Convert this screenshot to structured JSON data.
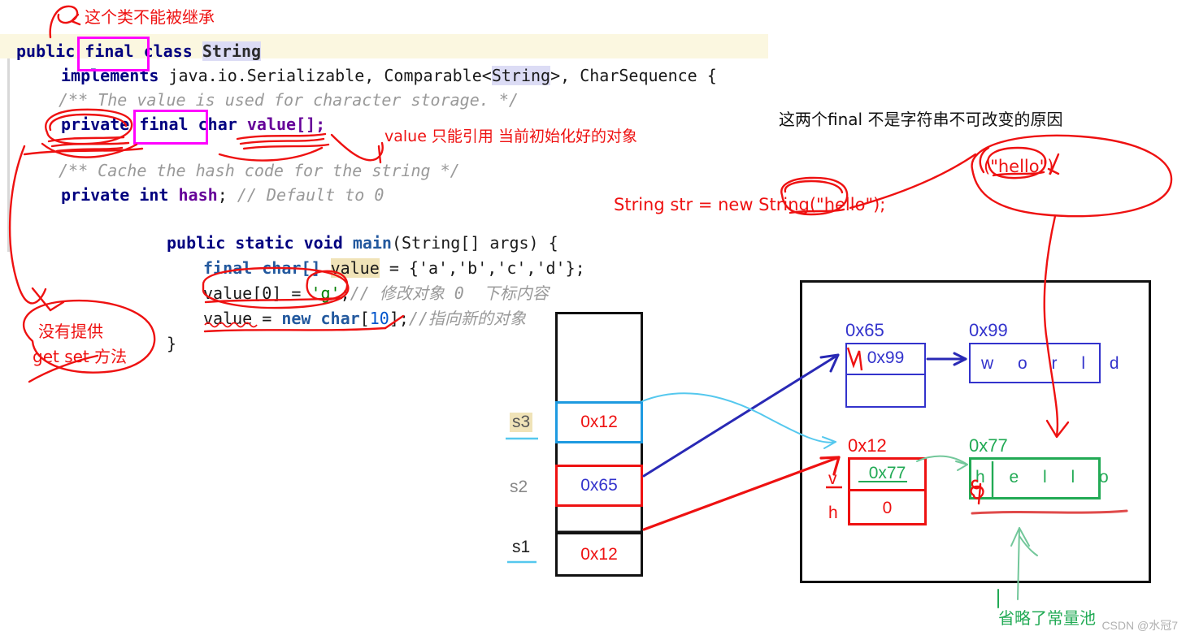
{
  "code": {
    "lines": [
      {
        "id": "l1",
        "text": "public final class String"
      },
      {
        "id": "l2",
        "text": "implements java.io.Serializable, Comparable<String>, CharSequence {"
      },
      {
        "id": "l3",
        "text": "/** The value is used for character storage. */"
      },
      {
        "id": "l4",
        "text": "private final char value[];"
      },
      {
        "id": "l5",
        "text": "/** Cache the hash code for the string */"
      },
      {
        "id": "l6",
        "text": "private int hash; // Default to 0"
      },
      {
        "id": "l7",
        "text": "public static void main(String[] args) {"
      },
      {
        "id": "l8",
        "text": "final char[] value = {'a','b','c','d'};"
      },
      {
        "id": "l9",
        "text": "value[0] = 'g';// 修改对象 0  下标内容"
      },
      {
        "id": "l10",
        "text": "value = new char[10];//指向新的对象"
      },
      {
        "id": "l11",
        "text": "}"
      }
    ],
    "tokens": {
      "public": "public",
      "final": "final",
      "class": "class",
      "string_type": "String",
      "implements": "implements",
      "serializable": "java.io.Serializable,",
      "comparable_pre": "Comparable<",
      "comparable_arg": "String",
      "comparable_post": ">, CharSequence {",
      "comment_value": "/** The value is used for character storage. */",
      "private": "private",
      "char": "char",
      "value_decl": "value[];",
      "comment_hash": "/** Cache the hash code for the string */",
      "int": "int",
      "hash": "hash",
      "semi": ";",
      "comment_default": "// Default to 0",
      "static": "static",
      "void": "void",
      "main": "main",
      "main_args": "(String[] args) {",
      "char_arr": "char[]",
      "value_name": "value",
      "assign_abcd": "= {'a','b','c','d'};",
      "value_idx": "value[0] =",
      "g_literal": "'g'",
      "semi2": ";",
      "comment_modify": "// 修改对象 0  下标内容",
      "value_eq": "value = ",
      "new": "new",
      "char2": "char",
      "bracket10_open": "[",
      "ten": "10",
      "bracket10_close": "];",
      "comment_newobj": "//指向新的对象",
      "close_brace": "}"
    }
  },
  "annotations": {
    "cannot_inherit": "这个类不能被继承",
    "value_ref_only": "value 只能引用 当前初始化好的对象",
    "two_final_reason": "这两个final  不是字符串不可改变的原因",
    "no_get_set_line1": "没有提供",
    "no_get_set_line2": "get  set 方法",
    "new_string_stmt": "String str = new String(\"hello\");",
    "hello_circled": "(\"hello\")",
    "constant_pool_omitted": "省略了常量池"
  },
  "stack": {
    "slots": [
      {
        "label": "s3",
        "value": "0x12",
        "border": "#1e9ae0",
        "value_color": "#ee1111"
      },
      {
        "label": "s2",
        "value": "0x65",
        "border": "#ee1111",
        "value_color": "#3333cc"
      },
      {
        "label": "s1",
        "value": "0x12",
        "border": "#111111",
        "value_color": "#ee1111"
      }
    ]
  },
  "heap": {
    "objects": [
      {
        "addr": "0x65",
        "color": "#3333cc",
        "field_value": "0x99",
        "field2_value": ""
      },
      {
        "addr": "0x99",
        "color": "#3333cc",
        "chars": "w o r l d"
      },
      {
        "addr": "0x12",
        "color": "#ee1111",
        "field_value": "0x77",
        "field2_value": "0",
        "field_labels": [
          "v",
          "h"
        ],
        "field_value_color": "#22aa55"
      },
      {
        "addr": "0x77",
        "color": "#22aa55",
        "chars": "h e l l o"
      }
    ]
  },
  "watermark": "CSDN @水冠7",
  "colors": {
    "red": "#ee1111",
    "blue": "#3333cc",
    "green": "#22aa55",
    "cyan": "#55c8ee",
    "magenta": "#ff00ff",
    "navy": "#000080",
    "highlight": "#fbf7e0"
  }
}
